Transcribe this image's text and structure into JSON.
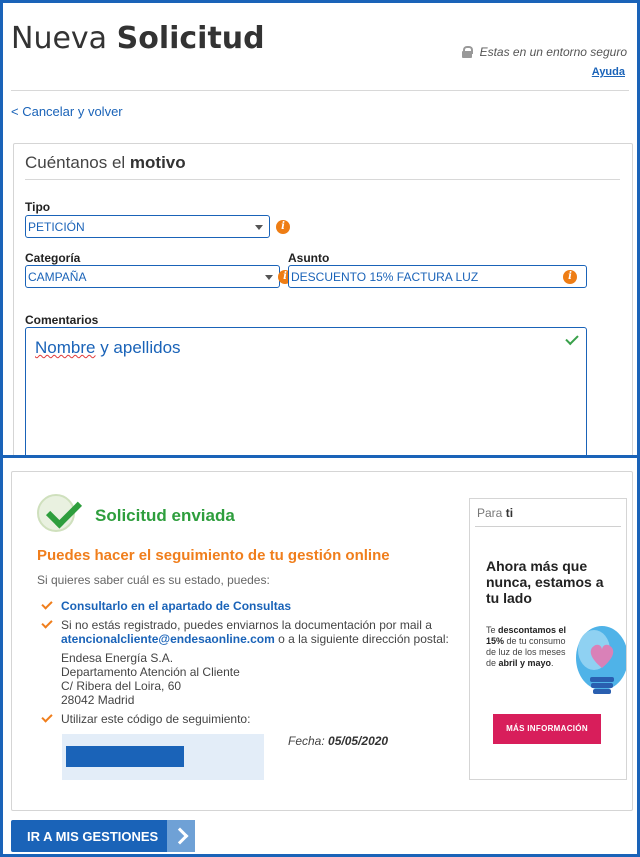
{
  "header": {
    "title_light": "Nueva",
    "title_bold": "Solicitud",
    "secure_text": "Estas en un entorno seguro",
    "help_link": "Ayuda",
    "back_link": "< Cancelar y volver"
  },
  "form": {
    "section_title_light": "Cuéntanos el",
    "section_title_bold": "motivo",
    "tipo": {
      "label": "Tipo",
      "value": "PETICIÓN"
    },
    "categoria": {
      "label": "Categoría",
      "value": "CAMPAÑA"
    },
    "asunto": {
      "label": "Asunto",
      "value": "DESCUENTO 15% FACTURA LUZ"
    },
    "comentarios": {
      "label": "Comentarios",
      "value_word1": "Nombre",
      "value_rest": " y apellidos"
    }
  },
  "confirmation": {
    "title": "Solicitud enviada",
    "follow_title": "Puedes hacer el seguimiento de tu gestión online",
    "hint": "Si quieres saber cuál es su estado, puedes:",
    "option1": "Consultarlo en el apartado de Consultas",
    "option2_part1": "Si no estás registrado, puedes enviarnos la documentación por mail a ",
    "option2_email": "atencionalcliente@endesaonline.com",
    "option2_part2": " o a la siguiente dirección postal:",
    "address_lines": [
      "Endesa Energía S.A.",
      "Departamento Atención al Cliente",
      "C/ Ribera del Loira, 60",
      "28042 Madrid"
    ],
    "option3": "Utilizar este código de seguimiento:",
    "fecha_label": "Fecha:",
    "fecha_value": "05/05/2020"
  },
  "promo": {
    "head_light": "Para",
    "head_bold": "ti",
    "title": "Ahora más que nunca, estamos a tu lado",
    "text_1": "Te ",
    "text_2": "descontamos el 15%",
    "text_3": " de tu consumo de luz de los meses de ",
    "text_4": "abril y mayo",
    "text_5": ".",
    "button": "MÁS INFORMACIÓN"
  },
  "cta": {
    "label": "IR A MIS GESTIONES"
  },
  "colors": {
    "brand_blue": "#1a63b8",
    "success_green": "#2e9e3d",
    "accent_orange": "#f07e1c",
    "promo_pink": "#d81e5b"
  },
  "icons": [
    "lock-icon",
    "info-icon",
    "checkmark-icon",
    "success-check-icon",
    "bullet-check-icon",
    "lightbulb-heart-icon",
    "chevron-right-icon"
  ]
}
